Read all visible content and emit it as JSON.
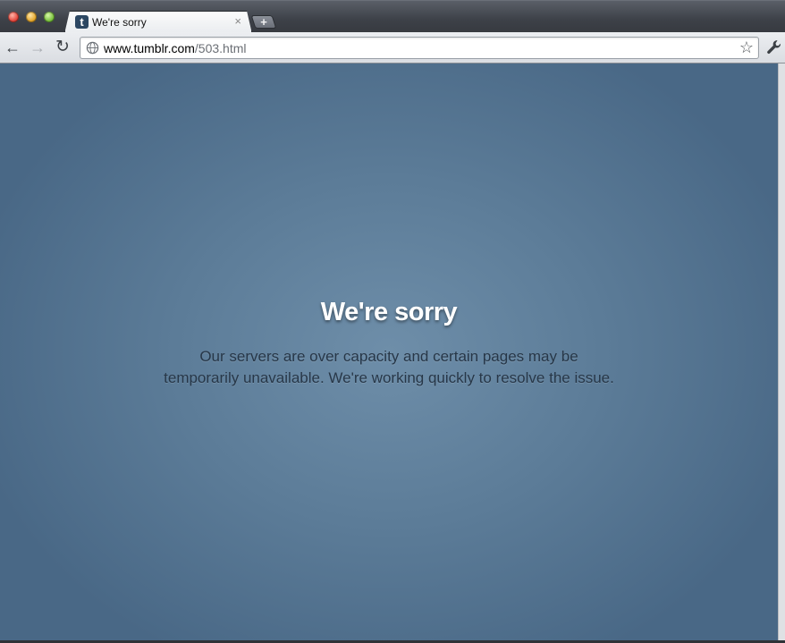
{
  "tab": {
    "title": "We're sorry",
    "favicon_letter": "t",
    "close_glyph": "×"
  },
  "new_tab": {
    "glyph": "+"
  },
  "toolbar": {
    "back_glyph": "←",
    "forward_glyph": "→",
    "reload_glyph": "↻",
    "star_glyph": "☆"
  },
  "url": {
    "host": "www.tumblr.com",
    "path": "/503.html"
  },
  "page": {
    "heading": "We're sorry",
    "message_line1": "Our servers are over capacity and certain pages may be",
    "message_line2": "temporarily unavailable. We're working quickly to resolve the issue."
  },
  "icons": {
    "page": "globe-icon",
    "bookmark": "star-icon",
    "menu": "wrench-icon"
  }
}
